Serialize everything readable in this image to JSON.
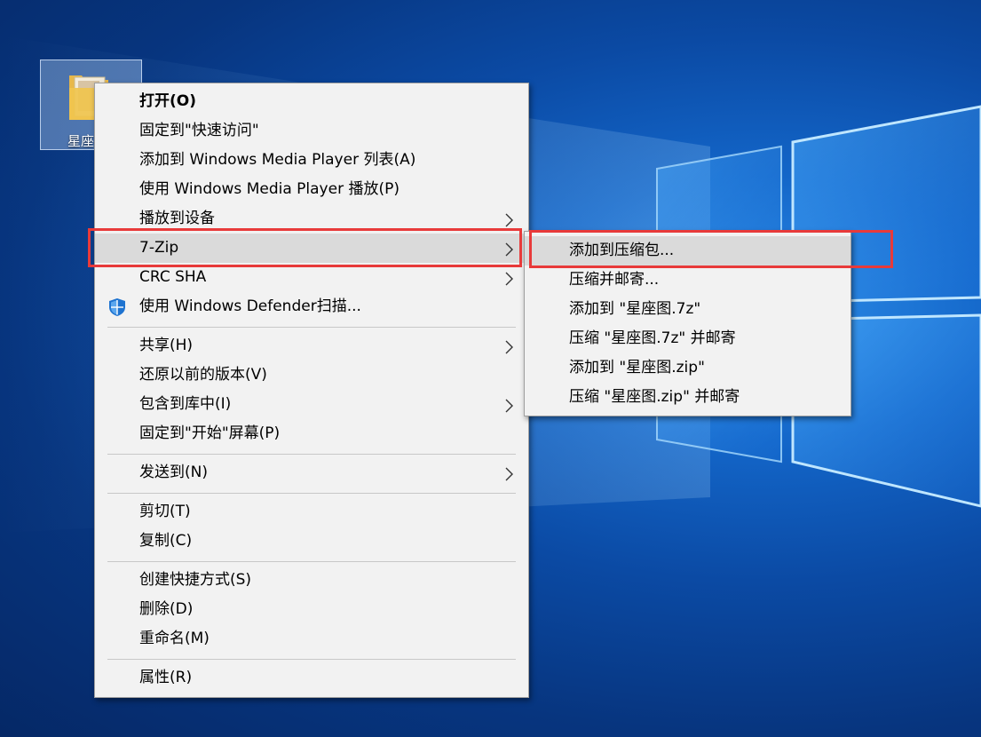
{
  "desktop": {
    "icon_label": "星座"
  },
  "context_menu": {
    "items": [
      {
        "label": "打开(O)"
      },
      {
        "label": "固定到\"快速访问\""
      },
      {
        "label": "添加到 Windows Media Player 列表(A)"
      },
      {
        "label": "使用 Windows Media Player 播放(P)"
      },
      {
        "label": "播放到设备"
      },
      {
        "label": "7-Zip"
      },
      {
        "label": "CRC SHA"
      },
      {
        "label": "使用 Windows Defender扫描..."
      },
      {
        "label": "共享(H)"
      },
      {
        "label": "还原以前的版本(V)"
      },
      {
        "label": "包含到库中(I)"
      },
      {
        "label": "固定到\"开始\"屏幕(P)"
      },
      {
        "label": "发送到(N)"
      },
      {
        "label": "剪切(T)"
      },
      {
        "label": "复制(C)"
      },
      {
        "label": "创建快捷方式(S)"
      },
      {
        "label": "删除(D)"
      },
      {
        "label": "重命名(M)"
      },
      {
        "label": "属性(R)"
      }
    ]
  },
  "submenu_7zip": {
    "items": [
      {
        "label": "添加到压缩包..."
      },
      {
        "label": "压缩并邮寄..."
      },
      {
        "label": "添加到 \"星座图.7z\""
      },
      {
        "label": "压缩 \"星座图.7z\" 并邮寄"
      },
      {
        "label": "添加到 \"星座图.zip\""
      },
      {
        "label": "压缩 \"星座图.zip\" 并邮寄"
      }
    ]
  },
  "colors": {
    "highlight_border": "#e83a3a",
    "menu_background": "#f2f2f2",
    "menu_hover": "#dadada",
    "desktop_blue": "#0b4aa4"
  }
}
